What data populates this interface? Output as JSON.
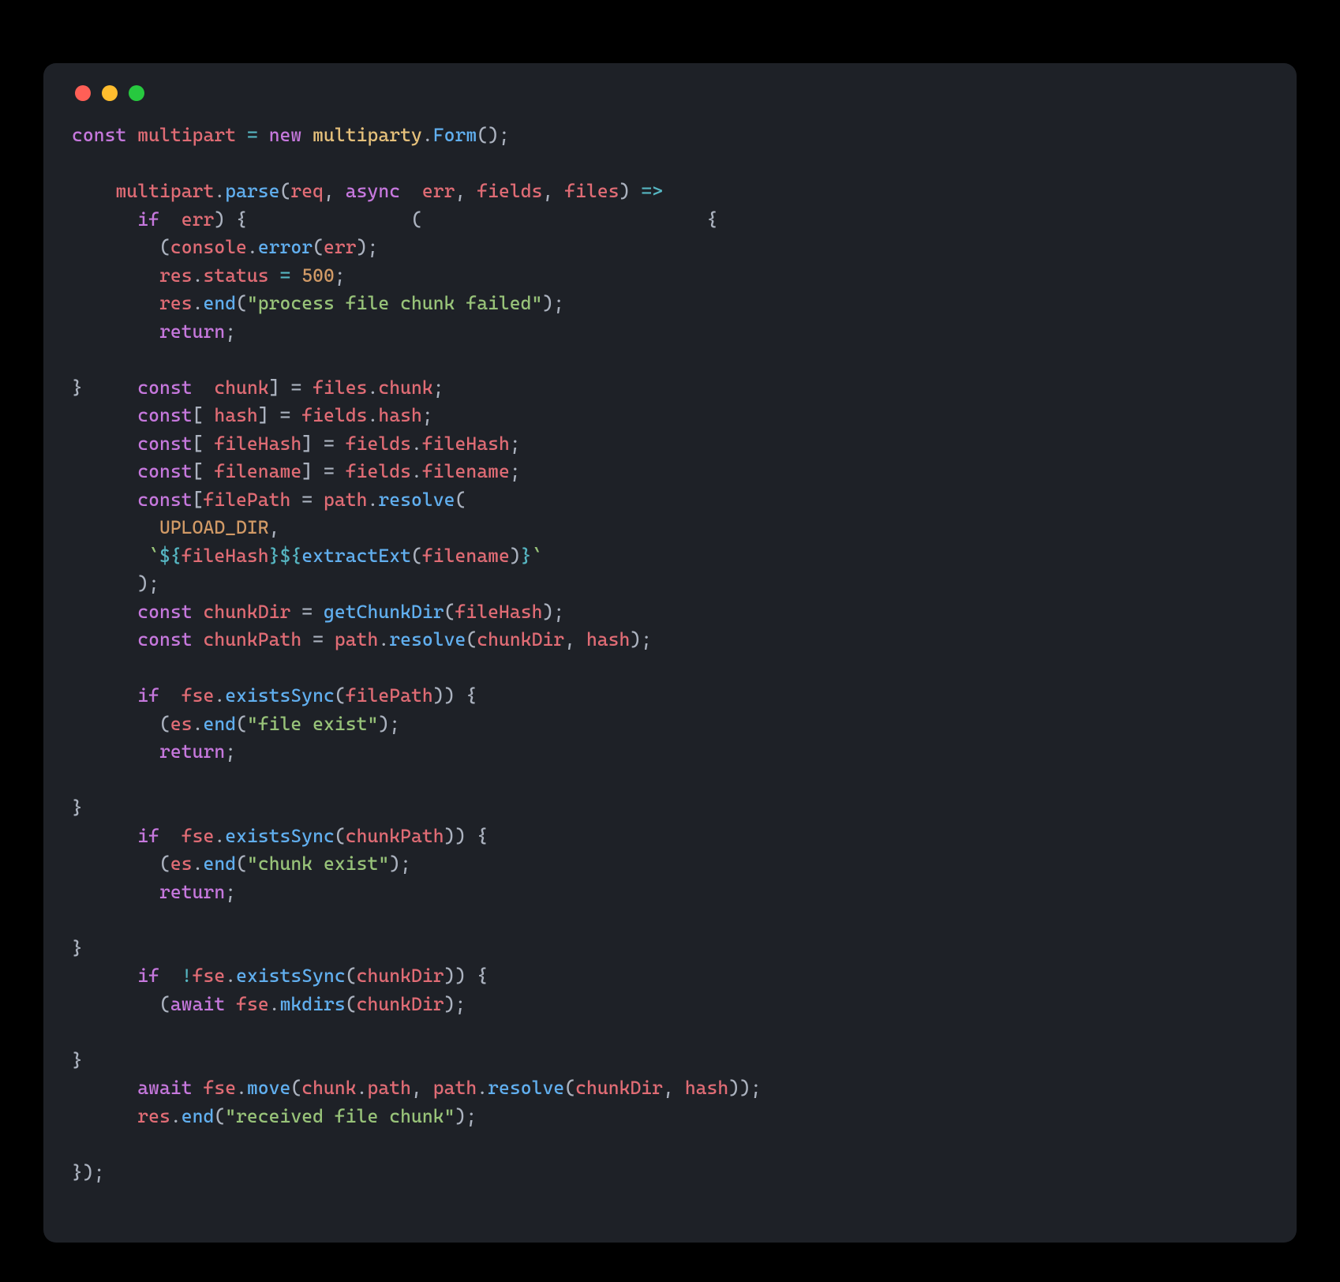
{
  "traffic": {
    "red": "#ff5f56",
    "yellow": "#ffbd2e",
    "green": "#27c93f"
  },
  "code": {
    "l1": {
      "a": "const",
      "b": "multipart",
      "c": "=",
      "d": "new",
      "e": "multiparty",
      "f": "Form",
      "g": "();"
    },
    "l3": {
      "a": "multipart",
      "b": "parse",
      "c": "req",
      "d": "async",
      "e": "err",
      "f": "fields",
      "g": "files",
      "h": "=>"
    },
    "l4": {
      "a": "if",
      "b": "err",
      "c": ") {",
      "p1": "(",
      "p2": "{"
    },
    "l5": {
      "a": "(",
      "b": "console",
      "c": "error",
      "d": "err",
      "e": ");"
    },
    "l6": {
      "a": "res",
      "b": "status",
      "c": "=",
      "d": "500",
      "e": ";"
    },
    "l7": {
      "a": "res",
      "b": "end",
      "c": "\"process file chunk failed\"",
      "d": ");"
    },
    "l8": {
      "a": "return",
      "b": ";"
    },
    "l10": {
      "a": "}",
      "b": "const",
      "c": "chunk",
      "d": "] = ",
      "e": "files",
      "f": "chunk",
      "g": ";"
    },
    "l11": {
      "a": "const",
      "b": "[ ",
      "c": "hash",
      "d": "] = ",
      "e": "fields",
      "f": "hash",
      "g": ";"
    },
    "l12": {
      "a": "const",
      "b": "[ ",
      "c": "fileHash",
      "d": "] = ",
      "e": "fields",
      "f": "fileHash",
      "g": ";"
    },
    "l13": {
      "a": "const",
      "b": "[ ",
      "c": "filename",
      "d": "] = ",
      "e": "fields",
      "f": "filename",
      "g": ";"
    },
    "l14": {
      "a": "const",
      "b": "[",
      "c": "filePath",
      "d": " = ",
      "e": "path",
      "f": "resolve",
      "g": "("
    },
    "l15": {
      "a": "UPLOAD_DIR",
      "b": ","
    },
    "l16": {
      "a": "`",
      "b": "${",
      "c": "fileHash",
      "d": "}",
      "e": "${",
      "f": "extractExt",
      "g": "filename",
      "h": "}",
      "i": "`"
    },
    "l17": {
      "a": ");"
    },
    "l18": {
      "a": "const",
      "b": "chunkDir",
      "c": " = ",
      "d": "getChunkDir",
      "e": "fileHash",
      "f": ");"
    },
    "l19": {
      "a": "const",
      "b": "chunkPath",
      "c": " = ",
      "d": "path",
      "e": "resolve",
      "f": "chunkDir",
      "g": "hash",
      "h": ");"
    },
    "l21": {
      "a": "if",
      "b": "fse",
      "c": "existsSync",
      "d": "filePath",
      "e": ")) {"
    },
    "l22": {
      "a": "(",
      "b": "es",
      "c": "end",
      "d": "\"file exist\"",
      "e": ");"
    },
    "l23": {
      "a": "return",
      "b": ";"
    },
    "l25": {
      "a": "}"
    },
    "l26": {
      "a": "if",
      "b": "fse",
      "c": "existsSync",
      "d": "chunkPath",
      "e": ")) {"
    },
    "l27": {
      "a": "(",
      "b": "es",
      "c": "end",
      "d": "\"chunk exist\"",
      "e": ");"
    },
    "l28": {
      "a": "return",
      "b": ";"
    },
    "l30": {
      "a": "}"
    },
    "l31": {
      "a": "if",
      "b": "!",
      "c": "fse",
      "d": "existsSync",
      "e": "chunkDir",
      "f": ")) {"
    },
    "l32": {
      "a": "(",
      "b": "await",
      "c": "fse",
      "d": "mkdirs",
      "e": "chunkDir",
      "f": ");"
    },
    "l34": {
      "a": "}"
    },
    "l35": {
      "a": "await",
      "b": "fse",
      "c": "move",
      "d": "chunk",
      "e": "path",
      "f": "path",
      "g": "resolve",
      "h": "chunkDir",
      "i": "hash",
      "j": "));"
    },
    "l36": {
      "a": "res",
      "b": "end",
      "c": "\"received file chunk\"",
      "d": ");"
    },
    "l38": {
      "a": "});"
    }
  }
}
